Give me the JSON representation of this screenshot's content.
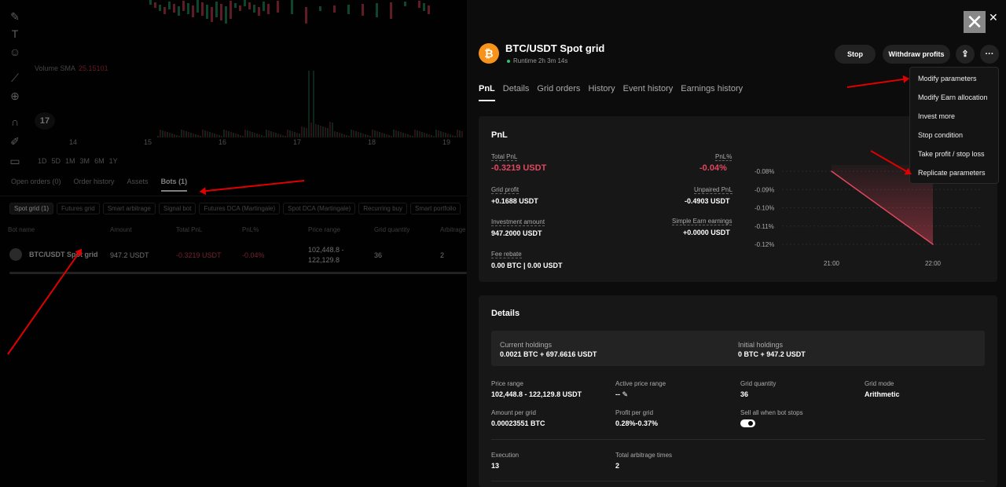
{
  "left": {
    "volume_label": "Volume SMA",
    "volume_value": "25.15101",
    "x_ticks": [
      "14",
      "15",
      "16",
      "17",
      "18",
      "19"
    ],
    "ranges": [
      "1D",
      "5D",
      "1M",
      "3M",
      "6M",
      "1Y"
    ],
    "tabs": [
      "Open orders (0)",
      "Order history",
      "Assets",
      "Bots (1)"
    ],
    "chips": [
      "Spot grid (1)",
      "Futures grid",
      "Smart arbitrage",
      "Signal bot",
      "Futures DCA (Martingale)",
      "Spot DCA (Martingale)",
      "Recurring buy",
      "Smart portfolio"
    ],
    "columns": [
      "Bot name",
      "Amount",
      "Total PnL",
      "PnL%",
      "Price range",
      "Grid quantity",
      "Arbitrage"
    ],
    "row": {
      "name": "BTC/USDT Spot grid",
      "amount": "947.2 USDT",
      "pnl": "-0.3219 USDT",
      "pnl_pct": "-0.04%",
      "range1": "102,448.8 -",
      "range2": "122,129.8",
      "grid_qty": "36",
      "arb": "2"
    },
    "tv_logo": "17"
  },
  "header": {
    "title": "BTC/USDT Spot grid",
    "runtime": "Runtime 2h 3m 14s",
    "stop": "Stop",
    "withdraw": "Withdraw profits",
    "coin_icon": "bitcoin-icon"
  },
  "tabs": [
    "PnL",
    "Details",
    "Grid orders",
    "History",
    "Event history",
    "Earnings history"
  ],
  "menu": [
    "Modify parameters",
    "Modify Earn allocation",
    "Invest more",
    "Stop condition",
    "Take profit / stop loss",
    "Replicate parameters"
  ],
  "pnl": {
    "heading": "PnL",
    "total_label": "Total PnL",
    "total_value": "-0.3219 USDT",
    "pct_label": "PnL%",
    "pct_value": "-0.04%",
    "grid_label": "Grid profit",
    "grid_value": "+0.1688 USDT",
    "unpaired_label": "Unpaired PnL",
    "unpaired_value": "-0.4903 USDT",
    "invest_label": "Investment amount",
    "invest_value": "947.2000 USDT",
    "earn_label": "Simple Earn earnings",
    "earn_value": "+0.0000 USDT",
    "fee_label": "Fee rebate",
    "fee_value": "0.00 BTC | 0.00 USDT"
  },
  "chart_data": {
    "type": "area",
    "x": [
      "21:00",
      "22:00"
    ],
    "series": [
      {
        "values": [
          -0.08,
          -0.12
        ]
      }
    ],
    "y_ticks": [
      "-0.08%",
      "-0.09%",
      "-0.10%",
      "-0.11%",
      "-0.12%"
    ],
    "ylim": [
      -0.12,
      -0.08
    ],
    "color": "#e0485e"
  },
  "details": {
    "heading": "Details",
    "current_label": "Current holdings",
    "current_value": "0.0021 BTC + 697.6616 USDT",
    "initial_label": "Initial holdings",
    "initial_value": "0 BTC + 947.2 USDT",
    "range_label": "Price range",
    "range_value": "102,448.8 - 122,129.8 USDT",
    "active_label": "Active price range",
    "active_value": "--",
    "qty_label": "Grid quantity",
    "qty_value": "36",
    "mode_label": "Grid mode",
    "mode_value": "Arithmetic",
    "amount_label": "Amount per grid",
    "amount_value": "0.00023551 BTC",
    "profit_label": "Profit per grid",
    "profit_value": "0.28%-0.37%",
    "sell_label": "Sell all when bot stops",
    "exec_label": "Execution",
    "exec_value": "13",
    "arb_label": "Total arbitrage times",
    "arb_value": "2"
  }
}
